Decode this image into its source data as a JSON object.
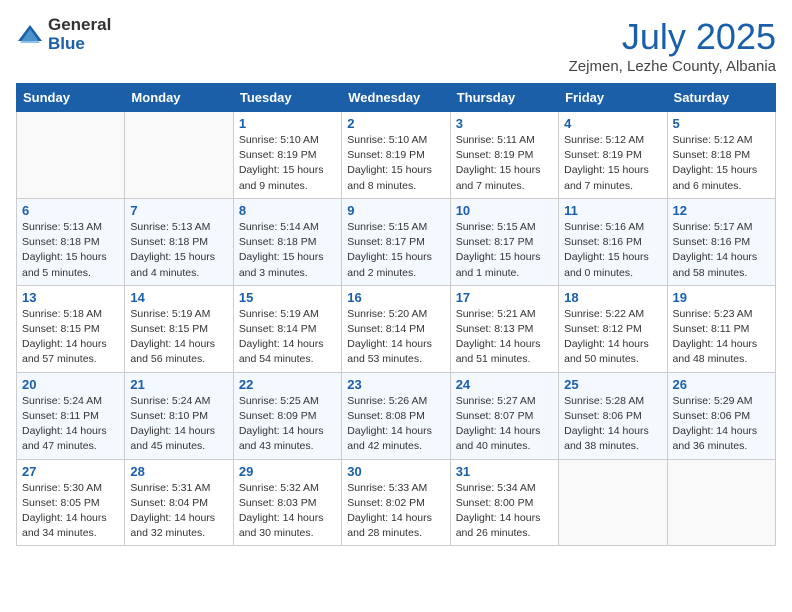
{
  "logo": {
    "general": "General",
    "blue": "Blue"
  },
  "header": {
    "month": "July 2025",
    "location": "Zejmen, Lezhe County, Albania"
  },
  "weekdays": [
    "Sunday",
    "Monday",
    "Tuesday",
    "Wednesday",
    "Thursday",
    "Friday",
    "Saturday"
  ],
  "weeks": [
    [
      {
        "day": "",
        "sunrise": "",
        "sunset": "",
        "daylight": ""
      },
      {
        "day": "",
        "sunrise": "",
        "sunset": "",
        "daylight": ""
      },
      {
        "day": "1",
        "sunrise": "Sunrise: 5:10 AM",
        "sunset": "Sunset: 8:19 PM",
        "daylight": "Daylight: 15 hours and 9 minutes."
      },
      {
        "day": "2",
        "sunrise": "Sunrise: 5:10 AM",
        "sunset": "Sunset: 8:19 PM",
        "daylight": "Daylight: 15 hours and 8 minutes."
      },
      {
        "day": "3",
        "sunrise": "Sunrise: 5:11 AM",
        "sunset": "Sunset: 8:19 PM",
        "daylight": "Daylight: 15 hours and 7 minutes."
      },
      {
        "day": "4",
        "sunrise": "Sunrise: 5:12 AM",
        "sunset": "Sunset: 8:19 PM",
        "daylight": "Daylight: 15 hours and 7 minutes."
      },
      {
        "day": "5",
        "sunrise": "Sunrise: 5:12 AM",
        "sunset": "Sunset: 8:18 PM",
        "daylight": "Daylight: 15 hours and 6 minutes."
      }
    ],
    [
      {
        "day": "6",
        "sunrise": "Sunrise: 5:13 AM",
        "sunset": "Sunset: 8:18 PM",
        "daylight": "Daylight: 15 hours and 5 minutes."
      },
      {
        "day": "7",
        "sunrise": "Sunrise: 5:13 AM",
        "sunset": "Sunset: 8:18 PM",
        "daylight": "Daylight: 15 hours and 4 minutes."
      },
      {
        "day": "8",
        "sunrise": "Sunrise: 5:14 AM",
        "sunset": "Sunset: 8:18 PM",
        "daylight": "Daylight: 15 hours and 3 minutes."
      },
      {
        "day": "9",
        "sunrise": "Sunrise: 5:15 AM",
        "sunset": "Sunset: 8:17 PM",
        "daylight": "Daylight: 15 hours and 2 minutes."
      },
      {
        "day": "10",
        "sunrise": "Sunrise: 5:15 AM",
        "sunset": "Sunset: 8:17 PM",
        "daylight": "Daylight: 15 hours and 1 minute."
      },
      {
        "day": "11",
        "sunrise": "Sunrise: 5:16 AM",
        "sunset": "Sunset: 8:16 PM",
        "daylight": "Daylight: 15 hours and 0 minutes."
      },
      {
        "day": "12",
        "sunrise": "Sunrise: 5:17 AM",
        "sunset": "Sunset: 8:16 PM",
        "daylight": "Daylight: 14 hours and 58 minutes."
      }
    ],
    [
      {
        "day": "13",
        "sunrise": "Sunrise: 5:18 AM",
        "sunset": "Sunset: 8:15 PM",
        "daylight": "Daylight: 14 hours and 57 minutes."
      },
      {
        "day": "14",
        "sunrise": "Sunrise: 5:19 AM",
        "sunset": "Sunset: 8:15 PM",
        "daylight": "Daylight: 14 hours and 56 minutes."
      },
      {
        "day": "15",
        "sunrise": "Sunrise: 5:19 AM",
        "sunset": "Sunset: 8:14 PM",
        "daylight": "Daylight: 14 hours and 54 minutes."
      },
      {
        "day": "16",
        "sunrise": "Sunrise: 5:20 AM",
        "sunset": "Sunset: 8:14 PM",
        "daylight": "Daylight: 14 hours and 53 minutes."
      },
      {
        "day": "17",
        "sunrise": "Sunrise: 5:21 AM",
        "sunset": "Sunset: 8:13 PM",
        "daylight": "Daylight: 14 hours and 51 minutes."
      },
      {
        "day": "18",
        "sunrise": "Sunrise: 5:22 AM",
        "sunset": "Sunset: 8:12 PM",
        "daylight": "Daylight: 14 hours and 50 minutes."
      },
      {
        "day": "19",
        "sunrise": "Sunrise: 5:23 AM",
        "sunset": "Sunset: 8:11 PM",
        "daylight": "Daylight: 14 hours and 48 minutes."
      }
    ],
    [
      {
        "day": "20",
        "sunrise": "Sunrise: 5:24 AM",
        "sunset": "Sunset: 8:11 PM",
        "daylight": "Daylight: 14 hours and 47 minutes."
      },
      {
        "day": "21",
        "sunrise": "Sunrise: 5:24 AM",
        "sunset": "Sunset: 8:10 PM",
        "daylight": "Daylight: 14 hours and 45 minutes."
      },
      {
        "day": "22",
        "sunrise": "Sunrise: 5:25 AM",
        "sunset": "Sunset: 8:09 PM",
        "daylight": "Daylight: 14 hours and 43 minutes."
      },
      {
        "day": "23",
        "sunrise": "Sunrise: 5:26 AM",
        "sunset": "Sunset: 8:08 PM",
        "daylight": "Daylight: 14 hours and 42 minutes."
      },
      {
        "day": "24",
        "sunrise": "Sunrise: 5:27 AM",
        "sunset": "Sunset: 8:07 PM",
        "daylight": "Daylight: 14 hours and 40 minutes."
      },
      {
        "day": "25",
        "sunrise": "Sunrise: 5:28 AM",
        "sunset": "Sunset: 8:06 PM",
        "daylight": "Daylight: 14 hours and 38 minutes."
      },
      {
        "day": "26",
        "sunrise": "Sunrise: 5:29 AM",
        "sunset": "Sunset: 8:06 PM",
        "daylight": "Daylight: 14 hours and 36 minutes."
      }
    ],
    [
      {
        "day": "27",
        "sunrise": "Sunrise: 5:30 AM",
        "sunset": "Sunset: 8:05 PM",
        "daylight": "Daylight: 14 hours and 34 minutes."
      },
      {
        "day": "28",
        "sunrise": "Sunrise: 5:31 AM",
        "sunset": "Sunset: 8:04 PM",
        "daylight": "Daylight: 14 hours and 32 minutes."
      },
      {
        "day": "29",
        "sunrise": "Sunrise: 5:32 AM",
        "sunset": "Sunset: 8:03 PM",
        "daylight": "Daylight: 14 hours and 30 minutes."
      },
      {
        "day": "30",
        "sunrise": "Sunrise: 5:33 AM",
        "sunset": "Sunset: 8:02 PM",
        "daylight": "Daylight: 14 hours and 28 minutes."
      },
      {
        "day": "31",
        "sunrise": "Sunrise: 5:34 AM",
        "sunset": "Sunset: 8:00 PM",
        "daylight": "Daylight: 14 hours and 26 minutes."
      },
      {
        "day": "",
        "sunrise": "",
        "sunset": "",
        "daylight": ""
      },
      {
        "day": "",
        "sunrise": "",
        "sunset": "",
        "daylight": ""
      }
    ]
  ]
}
